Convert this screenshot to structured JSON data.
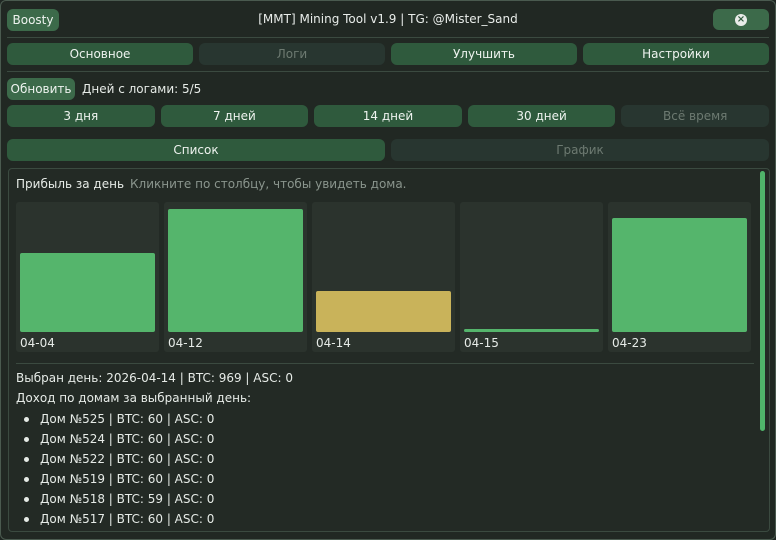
{
  "window": {
    "title": "[MMT] Mining Tool v1.9 | TG: @Mister_Sand",
    "boosty_label": "Boosty",
    "close_icon": "×"
  },
  "nav": {
    "tabs": [
      {
        "label": "Основное",
        "disabled": false
      },
      {
        "label": "Логи",
        "disabled": true
      },
      {
        "label": "Улучшить",
        "disabled": false
      },
      {
        "label": "Настройки",
        "disabled": false
      }
    ]
  },
  "logs": {
    "refresh_label": "Обновить",
    "days_label": "Дней с логами: 5/5"
  },
  "ranges": [
    {
      "label": "3 дня",
      "disabled": false
    },
    {
      "label": "7 дней",
      "disabled": false
    },
    {
      "label": "14 дней",
      "disabled": false
    },
    {
      "label": "30 дней",
      "disabled": false
    },
    {
      "label": "Всё время",
      "disabled": true
    }
  ],
  "views": [
    {
      "label": "Список",
      "disabled": false
    },
    {
      "label": "График",
      "disabled": true
    }
  ],
  "panel": {
    "title": "Прибыль за день",
    "hint": "Кликните по столбцу, чтобы увидеть дома."
  },
  "chart_data": {
    "type": "bar",
    "categories": [
      "04-04",
      "04-12",
      "04-14",
      "04-15",
      "04-23"
    ],
    "values": [
      0.63,
      0.98,
      0.33,
      0.02,
      0.91
    ],
    "selected_index": 2,
    "colors": {
      "normal": "#55b56c",
      "selected": "#c9b35a"
    }
  },
  "selection": {
    "summary": "Выбран день: 2026-04-14 | BTC: 969 | ASC: 0",
    "income_title": "Доход по домам за выбранный день:",
    "houses": [
      "Дом №525 | BTC: 60 | ASC: 0",
      "Дом №524 | BTC: 60 | ASC: 0",
      "Дом №522 | BTC: 60 | ASC: 0",
      "Дом №519 | BTC: 60 | ASC: 0",
      "Дом №518 | BTC: 59 | ASC: 0",
      "Дом №517 | BTC: 60 | ASC: 0"
    ]
  }
}
